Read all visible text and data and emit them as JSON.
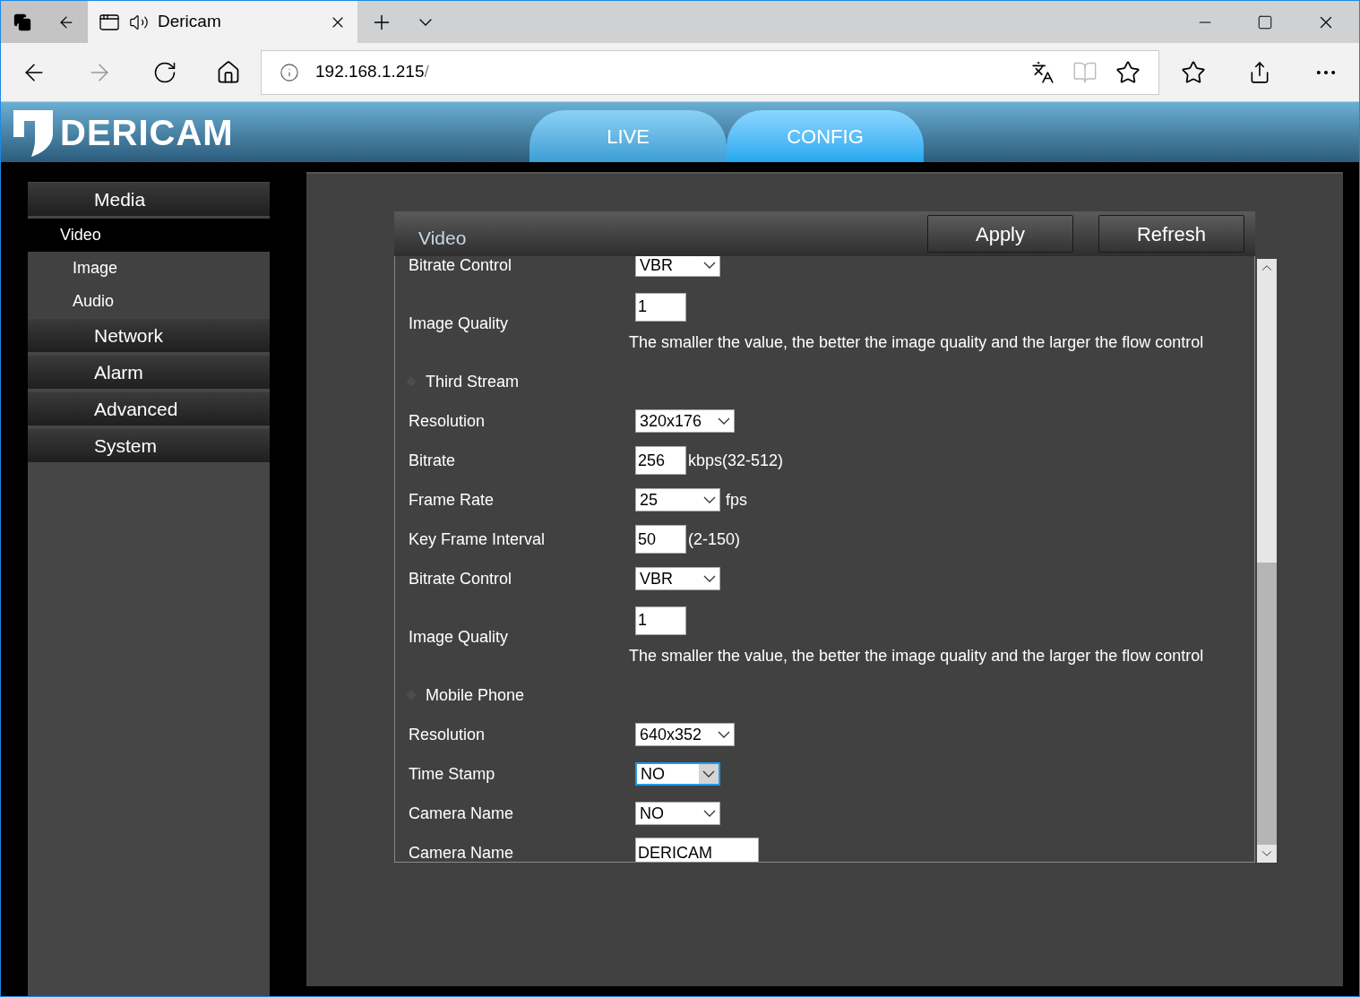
{
  "browser": {
    "tab_title": "Dericam",
    "address": "192.168.1.215",
    "address_suffix": "/"
  },
  "app": {
    "logo": "DERICAM",
    "tabs": [
      {
        "label": "LIVE",
        "selected": false
      },
      {
        "label": "CONFIG",
        "selected": true
      }
    ]
  },
  "sidebar": {
    "items": [
      {
        "label": "Media",
        "kind": "header",
        "selected": false
      },
      {
        "label": "Video",
        "kind": "sub",
        "selected": true
      },
      {
        "label": "Image",
        "kind": "sub",
        "selected": false
      },
      {
        "label": "Audio",
        "kind": "sub",
        "selected": false
      },
      {
        "label": "Network",
        "kind": "header",
        "selected": false
      },
      {
        "label": "Alarm",
        "kind": "header",
        "selected": false
      },
      {
        "label": "Advanced",
        "kind": "header",
        "selected": false
      },
      {
        "label": "System",
        "kind": "header",
        "selected": false
      }
    ]
  },
  "panel": {
    "title": "Video",
    "buttons": [
      "Apply",
      "Refresh"
    ],
    "rows": [
      {
        "kind": "select",
        "label": "Bitrate Control",
        "value": "VBR",
        "focused": false
      },
      {
        "kind": "quality",
        "label": "Image Quality",
        "value": "1",
        "hint": "The smaller the value, the better the image quality and the larger the flow control"
      },
      {
        "kind": "section",
        "label": "Third Stream"
      },
      {
        "kind": "select",
        "label": "Resolution",
        "value": "320x176",
        "focused": false
      },
      {
        "kind": "input",
        "label": "Bitrate",
        "value": "256",
        "suffix": "kbps(32-512)"
      },
      {
        "kind": "select",
        "label": "Frame Rate",
        "value": "25",
        "suffix": "fps",
        "focused": false
      },
      {
        "kind": "input",
        "label": "Key Frame Interval",
        "value": "50",
        "suffix": "(2-150)"
      },
      {
        "kind": "select",
        "label": "Bitrate Control",
        "value": "VBR",
        "focused": false
      },
      {
        "kind": "quality",
        "label": "Image Quality",
        "value": "1",
        "hint": "The smaller the value, the better the image quality and the larger the flow control"
      },
      {
        "kind": "section",
        "label": "Mobile Phone"
      },
      {
        "kind": "select",
        "label": "Resolution",
        "value": "640x352",
        "focused": false
      },
      {
        "kind": "select",
        "label": "Time Stamp",
        "value": "NO",
        "focused": true
      },
      {
        "kind": "select",
        "label": "Camera Name",
        "value": "NO",
        "focused": false
      },
      {
        "kind": "text",
        "label": "Camera Name",
        "value": "DERICAM"
      }
    ]
  }
}
